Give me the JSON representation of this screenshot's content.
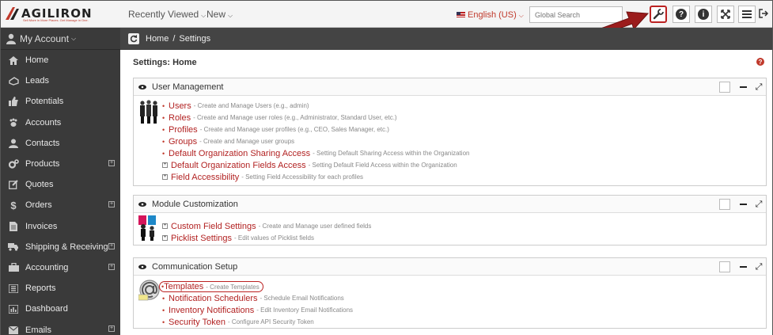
{
  "topbar": {
    "logo_text": "AGILIRON",
    "logo_tagline": "Sell More in More Places. Get Manage in One.",
    "recently_viewed": "Recently Viewed",
    "new_label": "New",
    "language": "English (US)",
    "search_placeholder": "Global Search"
  },
  "sidebar": {
    "account": "My Account",
    "items": [
      {
        "label": "Home"
      },
      {
        "label": "Leads"
      },
      {
        "label": "Potentials"
      },
      {
        "label": "Accounts"
      },
      {
        "label": "Contacts"
      },
      {
        "label": "Products"
      },
      {
        "label": "Quotes"
      },
      {
        "label": "Orders"
      },
      {
        "label": "Invoices"
      },
      {
        "label": "Shipping & Receiving"
      },
      {
        "label": "Accounting"
      },
      {
        "label": "Reports"
      },
      {
        "label": "Dashboard"
      },
      {
        "label": "Emails"
      }
    ]
  },
  "breadcrumb": {
    "home": "Home",
    "separator": "/",
    "current": "Settings"
  },
  "main": {
    "title": "Settings: Home",
    "panels": [
      {
        "title": "User Management",
        "rows": [
          {
            "name": "Users",
            "desc": "- Create and Manage Users (e.g., admin)"
          },
          {
            "name": "Roles",
            "desc": "- Create and Manage user roles (e.g., Administrator, Standard User, etc.)"
          },
          {
            "name": "Profiles",
            "desc": "- Create and Manage user profiles (e.g., CEO, Sales Manager, etc.)"
          },
          {
            "name": "Groups",
            "desc": "- Create and Manage user groups"
          },
          {
            "name": "Default Organization Sharing Access",
            "desc": "- Setting Default Sharing Access within the Organization"
          },
          {
            "name": "Default Organization Fields Access",
            "desc": "- Setting Default Field Access within the Organization"
          },
          {
            "name": "Field Accessibility",
            "desc": "- Setting Field Accessibility for each profiles"
          }
        ]
      },
      {
        "title": "Module Customization",
        "rows": [
          {
            "name": "Custom Field Settings",
            "desc": "- Create and Manage user defined fields"
          },
          {
            "name": "Picklist Settings",
            "desc": "- Edit values of Picklist fields"
          }
        ]
      },
      {
        "title": "Communication Setup",
        "rows": [
          {
            "name": "Templates",
            "desc": "- Create Templates"
          },
          {
            "name": "Notification Schedulers",
            "desc": "- Schedule Email Notifications"
          },
          {
            "name": "Inventory Notifications",
            "desc": "- Edit Inventory Email Notifications"
          },
          {
            "name": "Security Token",
            "desc": "- Configure API Security Token"
          }
        ]
      }
    ]
  },
  "colors": {
    "accent": "#b22222",
    "sidebar_bg": "#3a3a3a",
    "breadcrumb_bg": "#444444"
  }
}
